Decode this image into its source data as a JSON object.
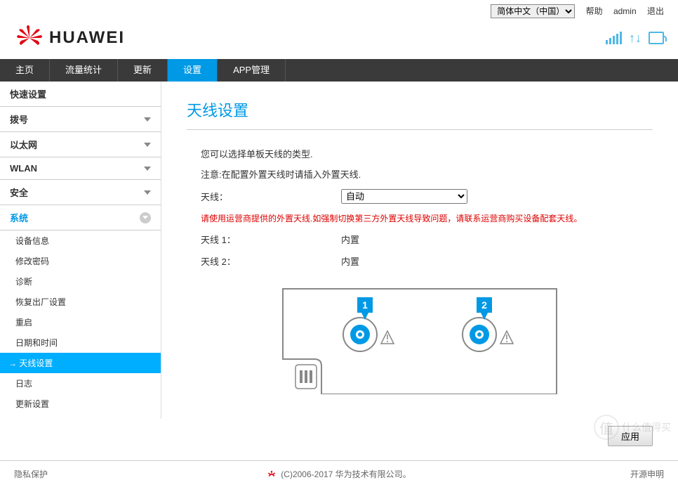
{
  "header": {
    "language_options": [
      "简体中文（中国）"
    ],
    "language_selected": "简体中文（中国）",
    "help": "帮助",
    "user": "admin",
    "logout": "退出",
    "brand": "HUAWEI"
  },
  "nav": {
    "items": [
      {
        "label": "主页",
        "active": false
      },
      {
        "label": "流量统计",
        "active": false
      },
      {
        "label": "更新",
        "active": false
      },
      {
        "label": "设置",
        "active": true
      },
      {
        "label": "APP管理",
        "active": false
      }
    ]
  },
  "sidebar": {
    "groups": [
      {
        "label": "快速设置",
        "expanded": false
      },
      {
        "label": "拨号",
        "expanded": false
      },
      {
        "label": "以太网",
        "expanded": false
      },
      {
        "label": "WLAN",
        "expanded": false
      },
      {
        "label": "安全",
        "expanded": false
      },
      {
        "label": "系统",
        "expanded": true,
        "items": [
          {
            "label": "设备信息",
            "active": false
          },
          {
            "label": "修改密码",
            "active": false
          },
          {
            "label": "诊断",
            "active": false
          },
          {
            "label": "恢复出厂设置",
            "active": false
          },
          {
            "label": "重启",
            "active": false
          },
          {
            "label": "日期和时间",
            "active": false
          },
          {
            "label": "天线设置",
            "active": true
          },
          {
            "label": "日志",
            "active": false
          },
          {
            "label": "更新设置",
            "active": false
          }
        ]
      }
    ]
  },
  "main": {
    "title": "天线设置",
    "desc1": "您可以选择单板天线的类型.",
    "desc2": "注意:在配置外置天线时请插入外置天线.",
    "antenna_label": "天线：",
    "antenna_options": [
      "自动"
    ],
    "antenna_selected": "自动",
    "warning": "请使用运营商提供的外置天线.如强制切换第三方外置天线导致问题，请联系运营商购买设备配套天线。",
    "antenna1_label": "天线 1：",
    "antenna1_value": "内置",
    "antenna2_label": "天线 2：",
    "antenna2_value": "内置",
    "diagram_badge1": "1",
    "diagram_badge2": "2",
    "apply": "应用"
  },
  "footer": {
    "privacy": "隐私保护",
    "copyright": "(C)2006-2017 华为技术有限公司。",
    "opensource": "开源申明"
  },
  "watermark": "什么值得买"
}
